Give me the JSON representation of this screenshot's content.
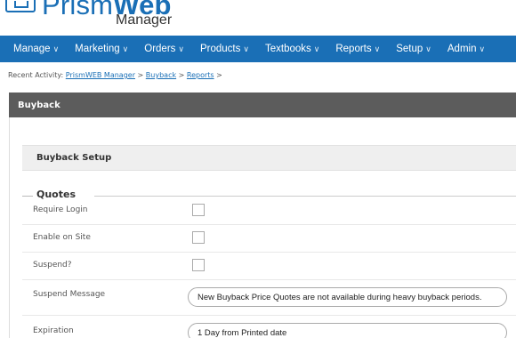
{
  "app": {
    "logo_text": "PrismWeb",
    "logo_bold": "Web",
    "logo_light": "Prism",
    "logo_sub": "Manager"
  },
  "nav": {
    "items": [
      {
        "label": "Manage"
      },
      {
        "label": "Marketing"
      },
      {
        "label": "Orders"
      },
      {
        "label": "Products"
      },
      {
        "label": "Textbooks"
      },
      {
        "label": "Reports"
      },
      {
        "label": "Setup"
      },
      {
        "label": "Admin"
      }
    ]
  },
  "breadcrumb": {
    "prefix": "Recent Activity:",
    "items": [
      "PrismWEB Manager",
      "Buyback",
      "Reports"
    ],
    "sep": ">"
  },
  "section": {
    "title": "Buyback"
  },
  "setup": {
    "title": "Buyback Setup",
    "group": "Quotes",
    "rows": [
      {
        "label": "Require Login",
        "checked": false
      },
      {
        "label": "Enable on Site",
        "checked": false
      },
      {
        "label": "Suspend?",
        "checked": false
      },
      {
        "label": "Suspend Message",
        "value": "New Buyback Price Quotes are not available during heavy buyback periods."
      },
      {
        "label": "Expiration",
        "value": "1 Day from Printed date"
      }
    ]
  }
}
